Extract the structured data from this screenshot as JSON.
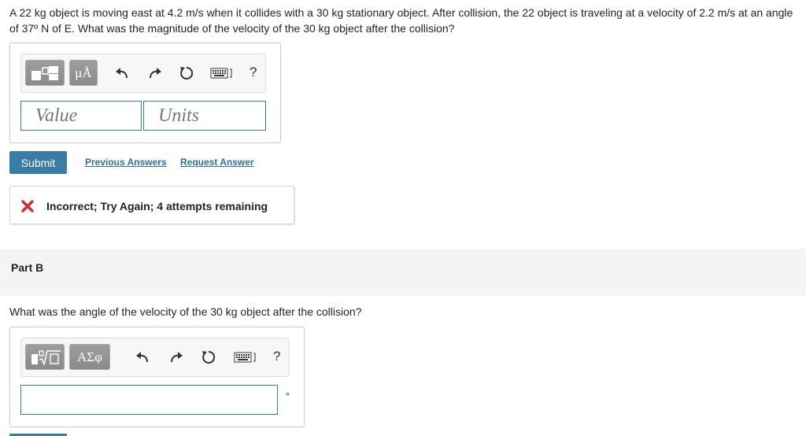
{
  "part_a": {
    "question": "A 22 kg object is moving east at 4.2 m/s when it collides with a 30 kg stationary object. After collision, the 22 object is traveling at a velocity of 2.2 m/s at an angle of 37º N of E. What was the magnitude of the velocity of the 30 kg object after the collision?",
    "toolbar": {
      "units_symbol": "μÅ",
      "help_label": "?"
    },
    "value_placeholder": "Value",
    "units_placeholder": "Units",
    "value": "",
    "units": "",
    "submit_label": "Submit",
    "previous_answers_label": "Previous Answers",
    "request_answer_label": "Request Answer",
    "feedback_message": "Incorrect; Try Again; 4 attempts remaining"
  },
  "part_b": {
    "title": "Part B",
    "question": "What was the angle of the velocity of the 30 kg object after the collision?",
    "toolbar": {
      "greek_symbol": "ΑΣφ",
      "help_label": "?"
    },
    "value": "",
    "unit_suffix": "°"
  },
  "colors": {
    "accent": "#3a7da4",
    "link": "#2f6f99",
    "error": "#d42a2a",
    "input_border": "#2f7ea6"
  }
}
